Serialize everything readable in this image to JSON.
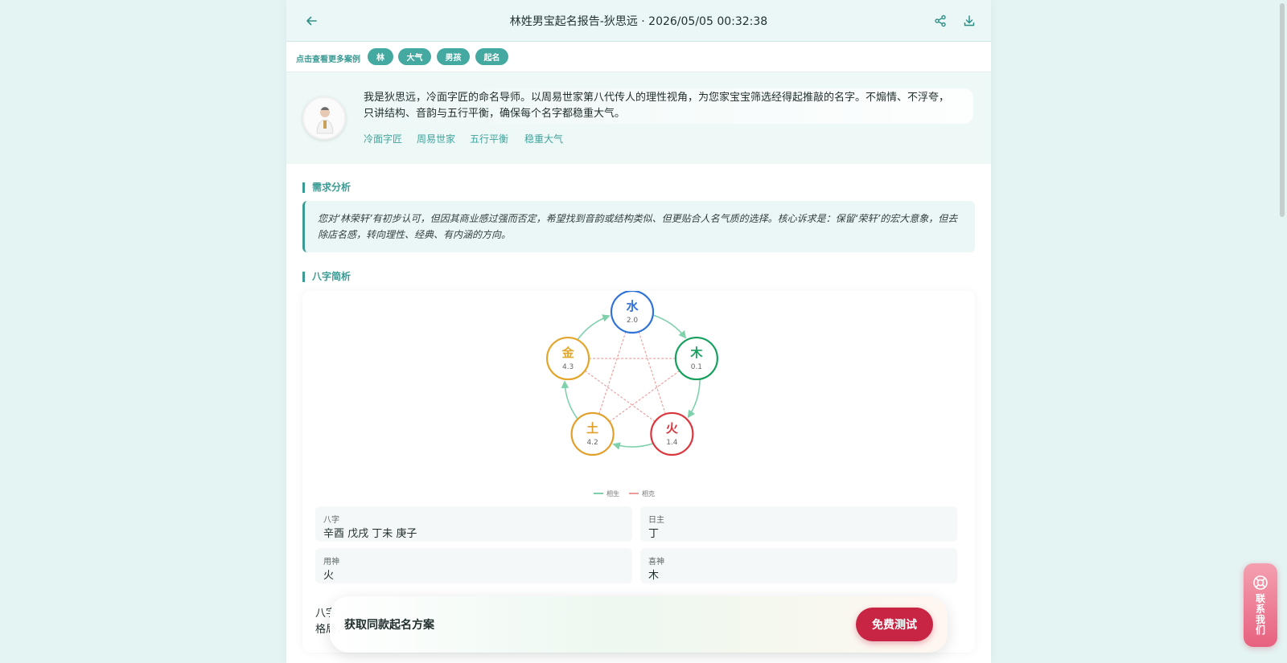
{
  "header": {
    "title": "林姓男宝起名报告-狄思远 · 2026/05/05 00:32:38"
  },
  "tagbar": {
    "label": "点击查看更多案例",
    "tags": [
      "林",
      "大气",
      "男孩",
      "起名"
    ]
  },
  "profile": {
    "bio": "我是狄思远，冷面字匠的命名导师。以周易世家第八代传人的理性视角，为您家宝宝筛选经得起推敲的名字。不煽情、不浮夸，只讲结构、音韵与五行平衡，确保每个名字都稳重大气。",
    "keywords": [
      "冷面字匠",
      "周易世家",
      "五行平衡",
      "稳重大气"
    ]
  },
  "sections": {
    "analysis_title": "需求分析",
    "analysis_text": "您对‘林荣轩’有初步认可，但因其商业感过强而否定，希望找到音韵或结构类似、但更贴合人名气质的选择。核心诉求是：保留‘荣轩’的宏大意象，但去除店名感，转向理性、经典、有内涵的方向。",
    "bazi_title": "八字简析"
  },
  "wuxing": {
    "elements": [
      {
        "key": "water",
        "name": "水",
        "value": "2.0",
        "color": "#2f73d9"
      },
      {
        "key": "wood",
        "name": "木",
        "value": "0.1",
        "color": "#17a05d"
      },
      {
        "key": "fire",
        "name": "火",
        "value": "1.4",
        "color": "#d9363e"
      },
      {
        "key": "earth",
        "name": "土",
        "value": "4.2",
        "color": "#e0a02a"
      },
      {
        "key": "metal",
        "name": "金",
        "value": "4.3",
        "color": "#e3a52a"
      }
    ],
    "legend": {
      "generate": "相生",
      "overcome": "相克"
    },
    "generate_color": "#7fd1ac",
    "overcome_color": "#ee9b9b"
  },
  "bazi": {
    "pillars_label": "八字",
    "pillars_value": "辛酉 戊戌 丁未 庚子",
    "day_master_label": "日主",
    "day_master_value": "丁",
    "useful_god_label": "用神",
    "useful_god_value": "火",
    "favorable_god_label": "喜神",
    "favorable_god_value": "木",
    "summary_partial": "八字　　　　　　　　　　　　　　　　　　　　　　　　　　　　　　　　　　　　　　　　　　　　　　　　　　　　　　　　　　　格局，"
  },
  "cta": {
    "text": "获取同款起名方案",
    "button": "免费测试"
  },
  "contact": {
    "label": "联系我们"
  }
}
